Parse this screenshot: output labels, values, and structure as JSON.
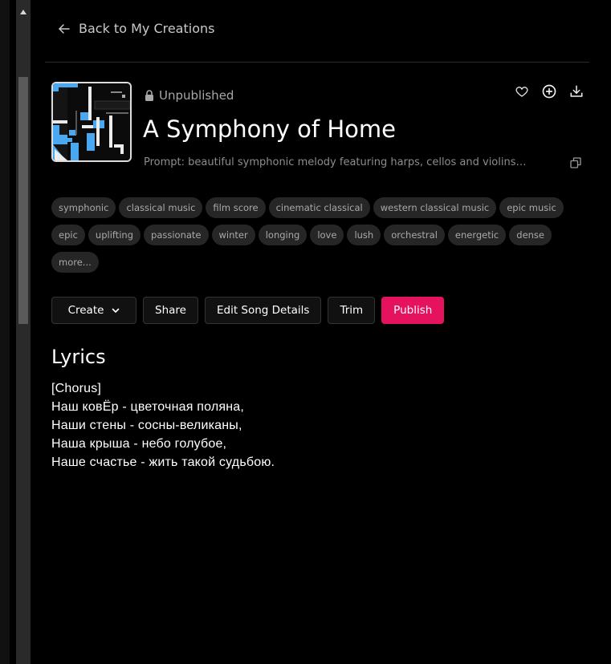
{
  "nav": {
    "back_label": "Back to My Creations"
  },
  "song": {
    "status": "Unpublished",
    "title": "A Symphony of Home",
    "prompt": "Prompt: beautiful symphonic melody featuring harps, cellos and violins,..."
  },
  "tags": [
    "symphonic",
    "classical music",
    "film score",
    "cinematic classical",
    "western classical music",
    "epic music",
    "epic",
    "uplifting",
    "passionate",
    "winter",
    "longing",
    "love",
    "lush",
    "orchestral",
    "energetic",
    "dense",
    "more..."
  ],
  "buttons": {
    "create": "Create",
    "share": "Share",
    "edit": "Edit Song Details",
    "trim": "Trim",
    "publish": "Publish"
  },
  "lyrics": {
    "heading": "Lyrics",
    "lines": [
      "[Chorus]",
      "Наш ковЁр - цветочная поляна,",
      "Наши стены - сосны-великаны,",
      "Наша крыша - небо голубое,",
      "Наше счастье - жить такой судьбою."
    ]
  },
  "colors": {
    "accent": "#e5135d",
    "background": "#000000",
    "tag_bg": "#262626",
    "cover_blue": "#4aa8f0"
  },
  "icons": [
    "arrow-left-icon",
    "lock-icon",
    "heart-icon",
    "plus-circle-icon",
    "download-icon",
    "copy-icon",
    "chevron-down-icon"
  ]
}
